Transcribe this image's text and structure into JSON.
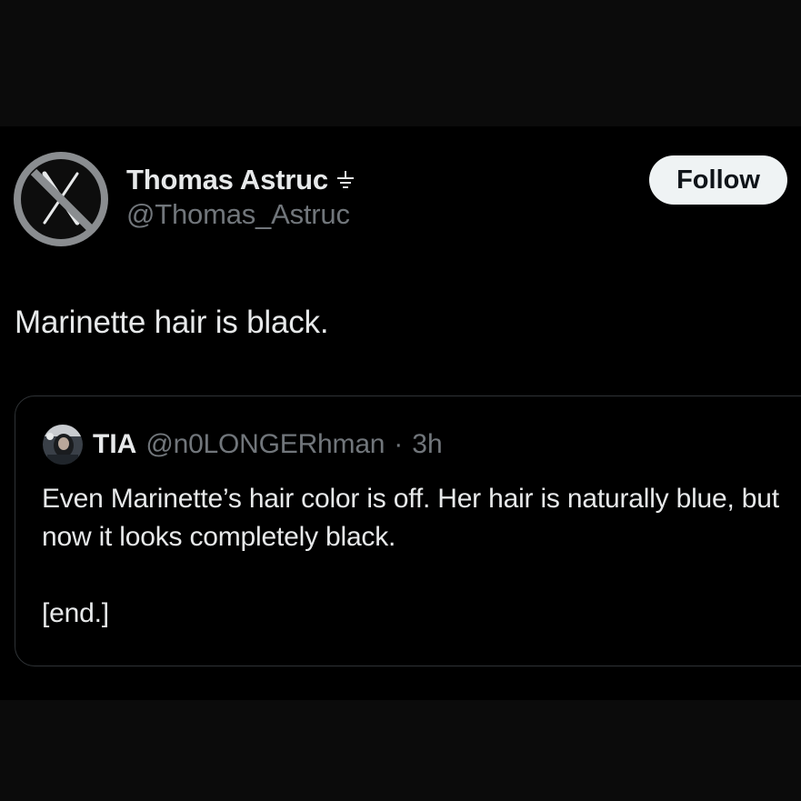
{
  "post": {
    "author": {
      "display_name": "Thomas Astruc",
      "handle": "@Thomas_Astruc",
      "avatar_icon": "crossed-out-x-logo-icon",
      "badge_icon": "ground-symbol-icon"
    },
    "follow_label": "Follow",
    "text": "Marinette hair is black."
  },
  "quoted_post": {
    "author": {
      "display_name": "TIA",
      "handle": "@n0LONGERhman",
      "avatar_icon": "user-avatar-icon"
    },
    "separator": "·",
    "time": "3h",
    "text_line1": "Even Marinette’s hair color is off. Her hair is naturally blue, but now it looks completely black.",
    "text_line2": "[end.]"
  },
  "colors": {
    "background": "#000000",
    "outer_band": "#0b0b0b",
    "primary_text": "#e7e9ea",
    "secondary_text": "#71767b",
    "follow_button_bg": "#eff3f4",
    "card_border": "#2f3336"
  }
}
